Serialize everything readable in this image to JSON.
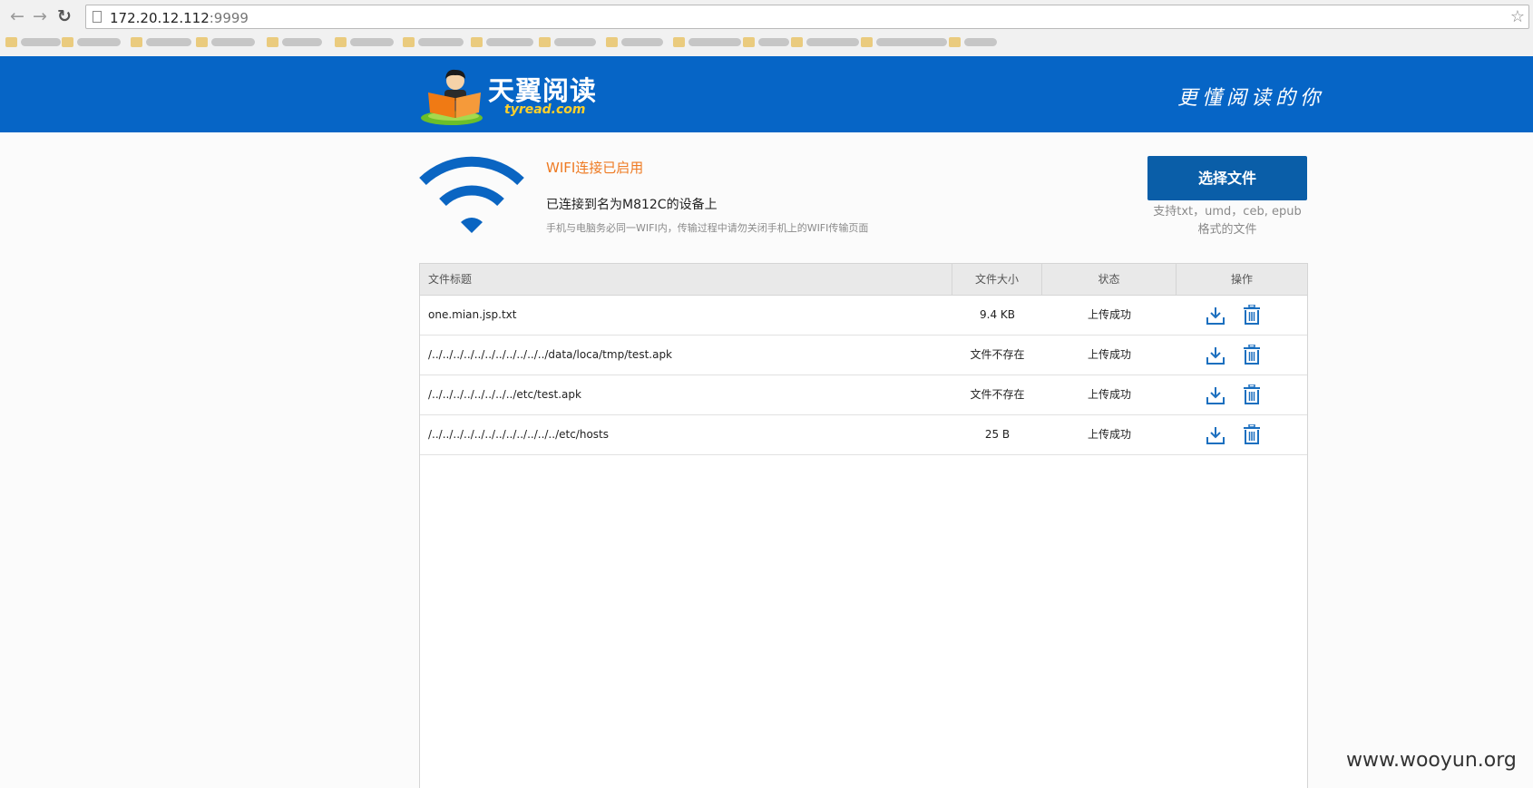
{
  "browser": {
    "url_host": "172.20.12.112",
    "url_port": ":9999"
  },
  "header": {
    "brand_cn": "天翼阅读",
    "brand_en": "tyread.com",
    "slogan": "更懂阅读的你"
  },
  "status": {
    "title": "WIFI连接已启用",
    "device": "已连接到名为M812C的设备上",
    "hint": "手机与电脑务必同一WIFI内，传输过程中请勿关闭手机上的WIFI传输页面"
  },
  "upload": {
    "button_label": "选择文件",
    "support_line1": "支持txt，umd，ceb, epub",
    "support_line2": "格式的文件"
  },
  "table": {
    "headers": {
      "title": "文件标题",
      "size": "文件大小",
      "state": "状态",
      "ops": "操作"
    },
    "rows": [
      {
        "title": "one.mian.jsp.txt",
        "size": "9.4 KB",
        "state": "上传成功"
      },
      {
        "title": "/../../../../../../../../../../../data/loca/tmp/test.apk",
        "size": "文件不存在",
        "state": "上传成功"
      },
      {
        "title": "/../../../../../../../../etc/test.apk",
        "size": "文件不存在",
        "state": "上传成功"
      },
      {
        "title": "/../../../../../../../../../../../../etc/hosts",
        "size": "25 B",
        "state": "上传成功"
      }
    ]
  },
  "watermark": "www.wooyun.org",
  "colors": {
    "header_blue": "#0665c6",
    "button_blue": "#0a5ea8",
    "accent_orange": "#ee7a22",
    "icon_blue": "#1b6fbf"
  }
}
